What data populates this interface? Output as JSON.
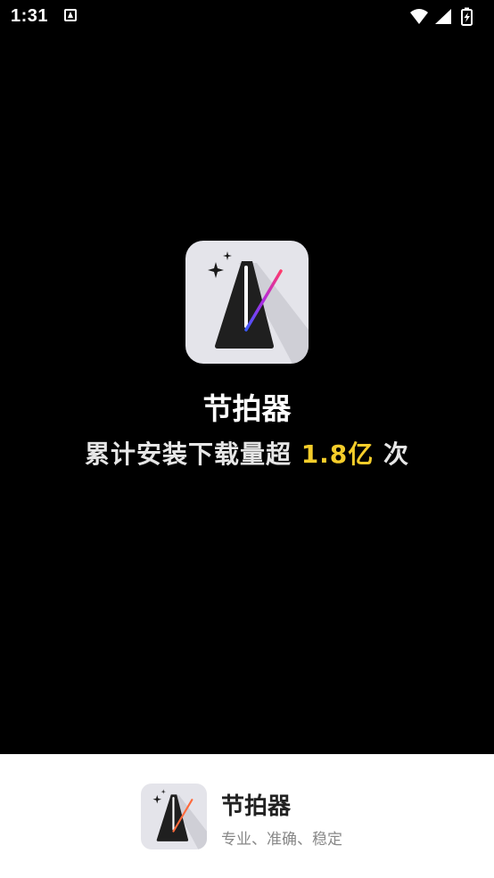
{
  "status_bar": {
    "time": "1:31",
    "icons": [
      "notification-a-icon",
      "wifi-icon",
      "cell-signal-icon",
      "battery-charging-icon"
    ]
  },
  "splash": {
    "app_name": "节拍器",
    "tagline_prefix": "累计安装下载量超 ",
    "tagline_highlight": "1.8亿",
    "tagline_suffix": " 次",
    "highlight_color": "#f5cd2a"
  },
  "bottom_brand": {
    "app_name": "节拍器",
    "slogan": "专业、准确、稳定"
  }
}
